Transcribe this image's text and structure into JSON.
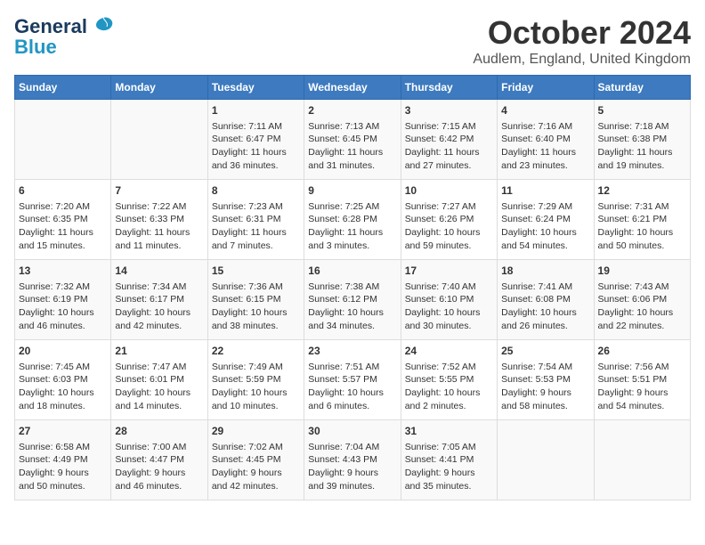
{
  "header": {
    "logo_general": "General",
    "logo_blue": "Blue",
    "month_title": "October 2024",
    "location": "Audlem, England, United Kingdom"
  },
  "days_of_week": [
    "Sunday",
    "Monday",
    "Tuesday",
    "Wednesday",
    "Thursday",
    "Friday",
    "Saturday"
  ],
  "weeks": [
    [
      {
        "day": "",
        "content": ""
      },
      {
        "day": "",
        "content": ""
      },
      {
        "day": "1",
        "content": "Sunrise: 7:11 AM\nSunset: 6:47 PM\nDaylight: 11 hours\nand 36 minutes."
      },
      {
        "day": "2",
        "content": "Sunrise: 7:13 AM\nSunset: 6:45 PM\nDaylight: 11 hours\nand 31 minutes."
      },
      {
        "day": "3",
        "content": "Sunrise: 7:15 AM\nSunset: 6:42 PM\nDaylight: 11 hours\nand 27 minutes."
      },
      {
        "day": "4",
        "content": "Sunrise: 7:16 AM\nSunset: 6:40 PM\nDaylight: 11 hours\nand 23 minutes."
      },
      {
        "day": "5",
        "content": "Sunrise: 7:18 AM\nSunset: 6:38 PM\nDaylight: 11 hours\nand 19 minutes."
      }
    ],
    [
      {
        "day": "6",
        "content": "Sunrise: 7:20 AM\nSunset: 6:35 PM\nDaylight: 11 hours\nand 15 minutes."
      },
      {
        "day": "7",
        "content": "Sunrise: 7:22 AM\nSunset: 6:33 PM\nDaylight: 11 hours\nand 11 minutes."
      },
      {
        "day": "8",
        "content": "Sunrise: 7:23 AM\nSunset: 6:31 PM\nDaylight: 11 hours\nand 7 minutes."
      },
      {
        "day": "9",
        "content": "Sunrise: 7:25 AM\nSunset: 6:28 PM\nDaylight: 11 hours\nand 3 minutes."
      },
      {
        "day": "10",
        "content": "Sunrise: 7:27 AM\nSunset: 6:26 PM\nDaylight: 10 hours\nand 59 minutes."
      },
      {
        "day": "11",
        "content": "Sunrise: 7:29 AM\nSunset: 6:24 PM\nDaylight: 10 hours\nand 54 minutes."
      },
      {
        "day": "12",
        "content": "Sunrise: 7:31 AM\nSunset: 6:21 PM\nDaylight: 10 hours\nand 50 minutes."
      }
    ],
    [
      {
        "day": "13",
        "content": "Sunrise: 7:32 AM\nSunset: 6:19 PM\nDaylight: 10 hours\nand 46 minutes."
      },
      {
        "day": "14",
        "content": "Sunrise: 7:34 AM\nSunset: 6:17 PM\nDaylight: 10 hours\nand 42 minutes."
      },
      {
        "day": "15",
        "content": "Sunrise: 7:36 AM\nSunset: 6:15 PM\nDaylight: 10 hours\nand 38 minutes."
      },
      {
        "day": "16",
        "content": "Sunrise: 7:38 AM\nSunset: 6:12 PM\nDaylight: 10 hours\nand 34 minutes."
      },
      {
        "day": "17",
        "content": "Sunrise: 7:40 AM\nSunset: 6:10 PM\nDaylight: 10 hours\nand 30 minutes."
      },
      {
        "day": "18",
        "content": "Sunrise: 7:41 AM\nSunset: 6:08 PM\nDaylight: 10 hours\nand 26 minutes."
      },
      {
        "day": "19",
        "content": "Sunrise: 7:43 AM\nSunset: 6:06 PM\nDaylight: 10 hours\nand 22 minutes."
      }
    ],
    [
      {
        "day": "20",
        "content": "Sunrise: 7:45 AM\nSunset: 6:03 PM\nDaylight: 10 hours\nand 18 minutes."
      },
      {
        "day": "21",
        "content": "Sunrise: 7:47 AM\nSunset: 6:01 PM\nDaylight: 10 hours\nand 14 minutes."
      },
      {
        "day": "22",
        "content": "Sunrise: 7:49 AM\nSunset: 5:59 PM\nDaylight: 10 hours\nand 10 minutes."
      },
      {
        "day": "23",
        "content": "Sunrise: 7:51 AM\nSunset: 5:57 PM\nDaylight: 10 hours\nand 6 minutes."
      },
      {
        "day": "24",
        "content": "Sunrise: 7:52 AM\nSunset: 5:55 PM\nDaylight: 10 hours\nand 2 minutes."
      },
      {
        "day": "25",
        "content": "Sunrise: 7:54 AM\nSunset: 5:53 PM\nDaylight: 9 hours\nand 58 minutes."
      },
      {
        "day": "26",
        "content": "Sunrise: 7:56 AM\nSunset: 5:51 PM\nDaylight: 9 hours\nand 54 minutes."
      }
    ],
    [
      {
        "day": "27",
        "content": "Sunrise: 6:58 AM\nSunset: 4:49 PM\nDaylight: 9 hours\nand 50 minutes."
      },
      {
        "day": "28",
        "content": "Sunrise: 7:00 AM\nSunset: 4:47 PM\nDaylight: 9 hours\nand 46 minutes."
      },
      {
        "day": "29",
        "content": "Sunrise: 7:02 AM\nSunset: 4:45 PM\nDaylight: 9 hours\nand 42 minutes."
      },
      {
        "day": "30",
        "content": "Sunrise: 7:04 AM\nSunset: 4:43 PM\nDaylight: 9 hours\nand 39 minutes."
      },
      {
        "day": "31",
        "content": "Sunrise: 7:05 AM\nSunset: 4:41 PM\nDaylight: 9 hours\nand 35 minutes."
      },
      {
        "day": "",
        "content": ""
      },
      {
        "day": "",
        "content": ""
      }
    ]
  ]
}
